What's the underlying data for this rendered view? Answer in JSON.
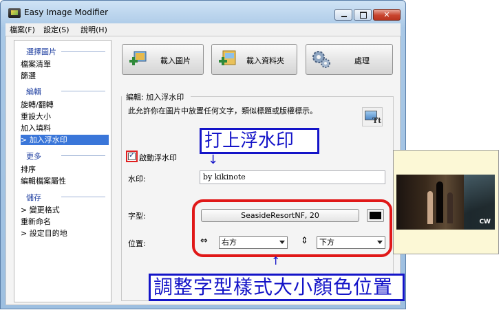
{
  "window": {
    "title": "Easy Image Modifier"
  },
  "menu": {
    "items": [
      "檔案(F)",
      "設定(S)",
      "說明(H)"
    ]
  },
  "sidebar": {
    "sections": [
      {
        "title": "選擇圖片",
        "items": [
          "檔案清單",
          "篩選"
        ]
      },
      {
        "title": "編輯",
        "items": [
          "旋轉/翻轉",
          "重設大小",
          "加入填料",
          "> 加入浮水印"
        ]
      },
      {
        "title": "更多",
        "items": [
          "排序",
          "編輯檔案屬性"
        ]
      },
      {
        "title": "儲存",
        "items": [
          "> 變更格式",
          "重新命名",
          "> 設定目的地"
        ]
      }
    ],
    "selected_item": "> 加入浮水印"
  },
  "toolbar": {
    "load_image": "載入圖片",
    "load_folder": "載入資料夾",
    "process": "處理"
  },
  "editor": {
    "group_title": "編輯: 加入浮水印",
    "description": "此允許你在圖片中放置任何文字，類似標題或版權標示。",
    "enable_label": "啟動浮水印",
    "enable_checked": true,
    "watermark_label": "水印:",
    "watermark_value": "by kikinote",
    "font_label": "字型:",
    "font_value": "SeasideResortNF, 20",
    "font_color": "#000000",
    "position_label": "位置:",
    "h_position": "右方",
    "v_position": "下方"
  },
  "annotations": {
    "top_callout": "打上浮水印",
    "bottom_callout": "調整字型樣式大小顏色位置",
    "arrow_down": "↓",
    "arrow_up": "↑"
  },
  "preview": {
    "logo_text": "CW"
  },
  "colors": {
    "callout_blue": "#1414c8",
    "highlight_red": "#e01818",
    "selection_blue": "#3a76d9",
    "preview_bg": "#fcf8d6"
  }
}
